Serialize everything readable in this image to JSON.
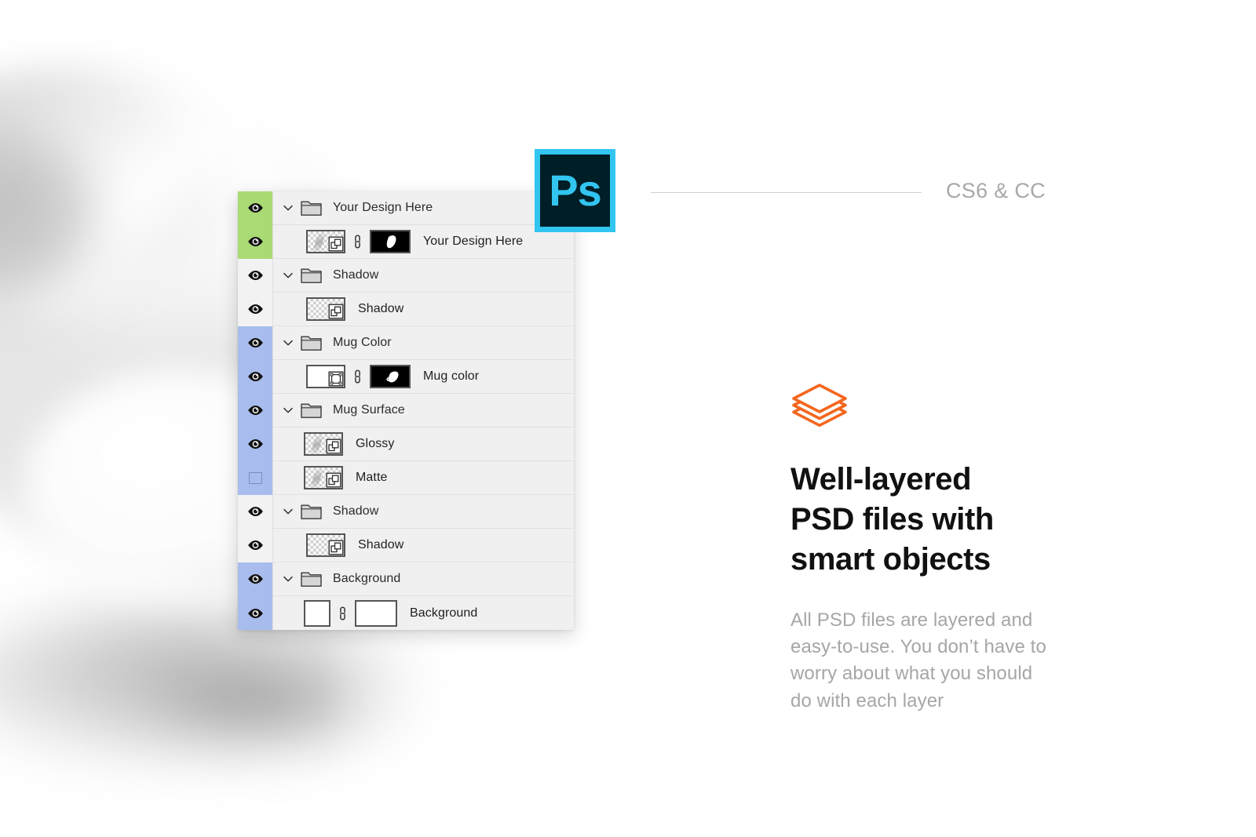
{
  "photoshop_icon": {
    "letters": "Ps",
    "border_color": "#31c5f0",
    "background_color": "#001e26"
  },
  "version_note": {
    "label": "CS6 & CC"
  },
  "feature": {
    "icon": "stacked-layers-icon",
    "icon_color": "#f4661e",
    "headline_lines": [
      "Well-layered",
      "PSD files with",
      "smart objects"
    ],
    "body_lines": [
      "All PSD files are layered and",
      "easy-to-use. You don’t have to",
      "worry about what you should",
      "do with each layer"
    ]
  },
  "layers_panel": {
    "colors": {
      "green": "#a9da74",
      "blue": "#a8bced",
      "plain": "#f2f2f2",
      "row_background": "#f0f0f0"
    },
    "rows": [
      {
        "name": "Your Design Here",
        "kind": "group",
        "visible": true,
        "swatch": "green",
        "expanded": true
      },
      {
        "name": "Your Design Here",
        "kind": "smart-object-masked",
        "visible": true,
        "swatch": "green",
        "thumbnail": "checkerboard-smart-object",
        "mask": "mug-silhouette-mask",
        "linked": true
      },
      {
        "name": "Shadow",
        "kind": "group",
        "visible": true,
        "swatch": "plain",
        "expanded": true
      },
      {
        "name": "Shadow",
        "kind": "smart-object",
        "visible": true,
        "swatch": "plain",
        "thumbnail": "checkerboard-smart-object"
      },
      {
        "name": "Mug Color",
        "kind": "group",
        "visible": true,
        "swatch": "blue",
        "expanded": true
      },
      {
        "name": "Mug color",
        "kind": "fill-masked",
        "visible": true,
        "swatch": "blue",
        "thumbnail": "white-fill",
        "mask": "mug-silhouette-mask",
        "linked": true
      },
      {
        "name": "Mug Surface",
        "kind": "group",
        "visible": true,
        "swatch": "blue",
        "expanded": true
      },
      {
        "name": "Glossy",
        "kind": "smart-object",
        "visible": true,
        "swatch": "blue",
        "thumbnail": "checkerboard-smart-object"
      },
      {
        "name": "Matte",
        "kind": "smart-object",
        "visible": false,
        "swatch": "blue",
        "thumbnail": "checkerboard-smart-object"
      },
      {
        "name": "Shadow",
        "kind": "group",
        "visible": true,
        "swatch": "plain",
        "expanded": true
      },
      {
        "name": "Shadow",
        "kind": "smart-object",
        "visible": true,
        "swatch": "plain",
        "thumbnail": "checkerboard-smart-object"
      },
      {
        "name": "Background",
        "kind": "group",
        "visible": true,
        "swatch": "blue",
        "expanded": true
      },
      {
        "name": "Background",
        "kind": "fill-masked",
        "visible": true,
        "swatch": "blue",
        "thumbnail": "white-fill",
        "mask": "white-mask",
        "linked": true
      }
    ]
  }
}
